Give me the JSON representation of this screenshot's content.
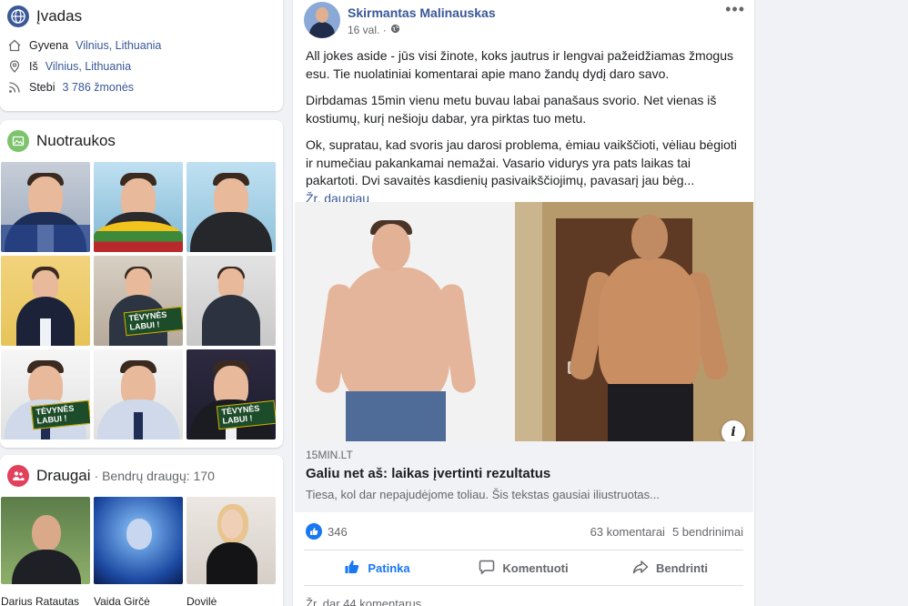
{
  "intro": {
    "title": "Įvadas",
    "lives_prefix": "Gyvena",
    "lives_place": "Vilnius, Lithuania",
    "from_prefix": "Iš",
    "from_place": "Vilnius, Lithuania",
    "follow_prefix": "Stebi",
    "follow_count": "3 786 žmonės"
  },
  "photos": {
    "title": "Nuotraukos",
    "badge_text": "TĖVYNĖS LABUI !"
  },
  "friends": {
    "title": "Draugai",
    "mutual": "· Bendrų draugų: 170",
    "items": [
      {
        "name": "Darius Ratautas"
      },
      {
        "name": "Vaida Girčė"
      },
      {
        "name": "Dovilė"
      }
    ]
  },
  "post": {
    "author": "Skirmantas Malinauskas",
    "time": "16 val. ·",
    "more_label": "•••",
    "paragraphs": [
      "All jokes aside - jūs visi žinote, koks jautrus ir lengvai pažeidžiamas žmogus esu. Tie nuolatiniai komentarai apie mano žandų dydį daro savo.",
      "Dirbdamas 15min vienu metu buvau labai panašaus svorio. Net vienas iš kostiumų, kurį nešioju dabar, yra pirktas tuo metu.",
      "Ok, supratau, kad svoris jau darosi problema, ėmiau vaikščioti, vėliau bėgioti ir numečiau pakankamai nemažai. Vasario vidurys yra pats laikas tai pakartoti. Dvi savaitės kasdienių pasivaikščiojimų, pavasarį jau bėg..."
    ],
    "see_more": "Žr. daugiau",
    "info_label": "i",
    "link": {
      "domain": "15MIN.LT",
      "title": "Galiu net aš: laikas įvertinti rezultatus",
      "description": "Tiesa, kol dar nepajudėjome toliau. Šis tekstas gausiai iliustruotas..."
    },
    "reactions": "346",
    "comments": "63 komentarai",
    "shares": "5 bendrinimai",
    "actions": {
      "like": "Patinka",
      "comment": "Komentuoti",
      "share": "Bendrinti"
    },
    "view_comments": "Žr. dar 44 komentarus"
  },
  "colors": {
    "link_blue": "#385898",
    "facebook_blue": "#1877f2",
    "background": "#f0f2f5"
  },
  "icons": [
    "globe-icon",
    "home-icon",
    "location-pin-icon",
    "rss-icon",
    "photos-icon",
    "friends-icon",
    "privacy-globe-icon",
    "more-icon",
    "like-icon",
    "comment-icon",
    "share-icon",
    "info-icon"
  ]
}
